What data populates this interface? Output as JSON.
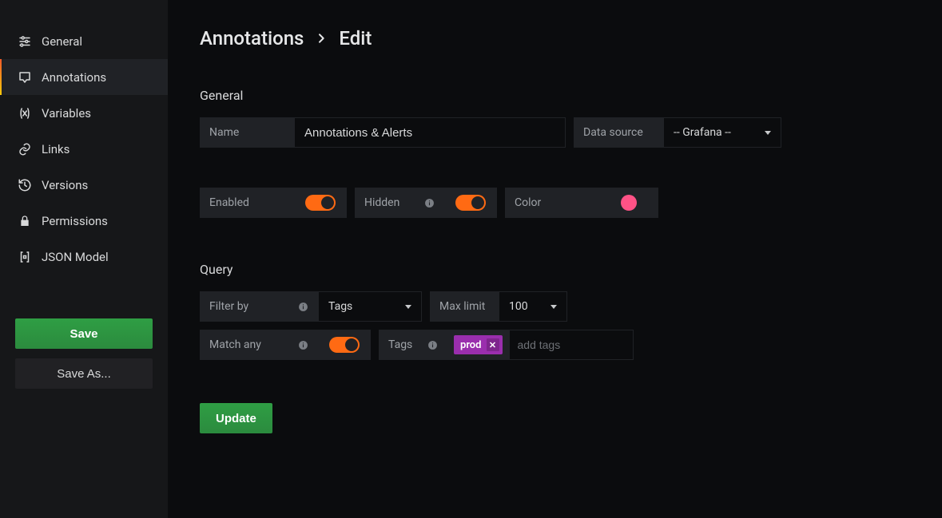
{
  "sidebar": {
    "items": [
      {
        "label": "General",
        "icon": "sliders-icon"
      },
      {
        "label": "Annotations",
        "icon": "comment-icon",
        "active": true
      },
      {
        "label": "Variables",
        "icon": "variable-icon"
      },
      {
        "label": "Links",
        "icon": "link-icon"
      },
      {
        "label": "Versions",
        "icon": "history-icon"
      },
      {
        "label": "Permissions",
        "icon": "lock-icon"
      },
      {
        "label": "JSON Model",
        "icon": "brackets-icon"
      }
    ],
    "save_label": "Save",
    "save_as_label": "Save As..."
  },
  "breadcrumbs": {
    "root": "Annotations",
    "leaf": "Edit"
  },
  "general": {
    "section_title": "General",
    "name_label": "Name",
    "name_value": "Annotations & Alerts",
    "datasource_label": "Data source",
    "datasource_value": "-- Grafana --",
    "enabled_label": "Enabled",
    "enabled_value": true,
    "hidden_label": "Hidden",
    "hidden_value": true,
    "color_label": "Color",
    "color_value": "#ff5286"
  },
  "query": {
    "section_title": "Query",
    "filter_by_label": "Filter by",
    "filter_by_value": "Tags",
    "max_limit_label": "Max limit",
    "max_limit_value": "100",
    "match_any_label": "Match any",
    "match_any_value": true,
    "tags_label": "Tags",
    "tags": [
      "prod"
    ],
    "tags_placeholder": "add tags"
  },
  "actions": {
    "update": "Update"
  }
}
